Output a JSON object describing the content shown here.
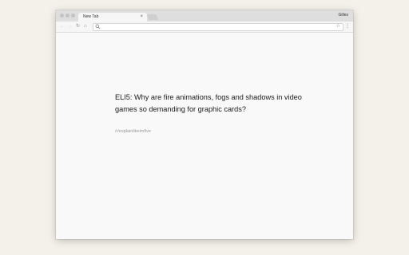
{
  "browser": {
    "tab": {
      "title": "New Tab",
      "close_icon": "×"
    },
    "profile_name": "Gilles",
    "toolbar": {
      "back_icon": "←",
      "forward_icon": "→",
      "reload_icon": "↻",
      "home_icon": "⌂",
      "bookmark_icon": "☆",
      "menu_icon": "⋮"
    },
    "address_bar": {
      "value": ""
    }
  },
  "content": {
    "headline": "ELI5: Why are fire animations, fogs and shadows in video games so demanding for graphic cards?",
    "subreddit": "/r/explainlikeimfive"
  },
  "colors": {
    "desktop_background": "#f4f1ea",
    "page_background": "#f9f9f9",
    "headline_text": "#1a1a1a",
    "subreddit_text": "#9a9a9a"
  }
}
